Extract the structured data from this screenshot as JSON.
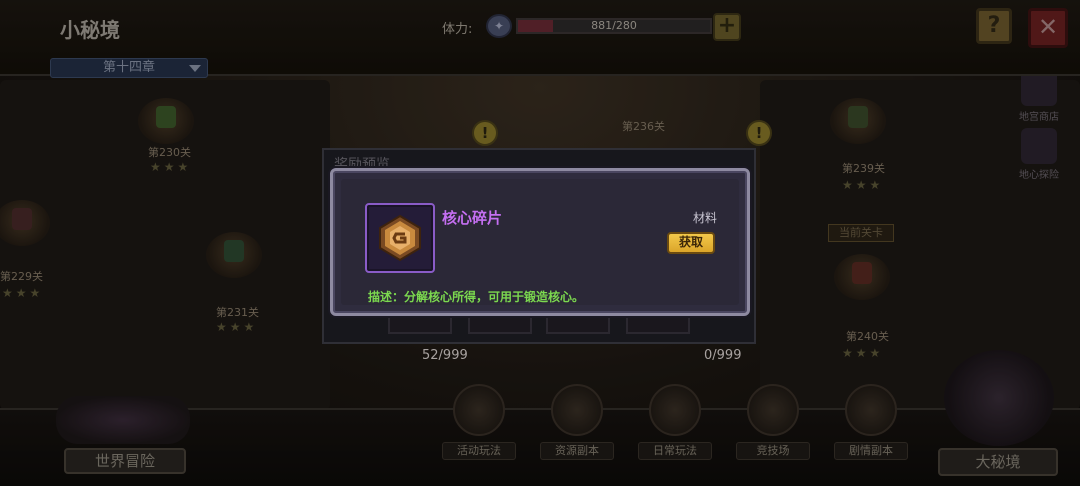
{
  "header": {
    "title": "小秘境",
    "chapter": "第十四章",
    "stamina_label": "体力:",
    "stamina_text": "881/280",
    "stamina_fraction": 0.18
  },
  "map": {
    "stages": [
      {
        "label": "第230关"
      },
      {
        "label": "第229关"
      },
      {
        "label": "第231关"
      },
      {
        "label": "第239关"
      },
      {
        "label": "第240关"
      },
      {
        "label": "第236关"
      }
    ],
    "current_stage": "当前关卡",
    "star_glyph": "★★★",
    "alert_glyph": "!"
  },
  "side": {
    "shop_label": "地宫商店",
    "explore_label": "地心探险"
  },
  "reward_panel": {
    "title": "奖励预览",
    "count_left": "52/999",
    "count_right": "0/999"
  },
  "dialog": {
    "item_name": "核心碎片",
    "item_type": "材料",
    "obtain_label": "获取",
    "description": "描述：分解核心所得，可用于锻造核心。"
  },
  "bottom_nav": {
    "world": "世界冒险",
    "activity": "活动玩法",
    "resource": "资源副本",
    "daily": "日常玩法",
    "arena": "竞技场",
    "story": "剧情副本",
    "big_secret": "大秘境"
  },
  "colors": {
    "item_name": "#c56ff2",
    "description": "#7bd84f",
    "obtain_button": "#f3c84a",
    "item_frame": "#8a5cc7"
  },
  "icons": {
    "item": "core-fragment-icon",
    "help": "question-mark-icon",
    "close": "close-x-icon",
    "stamina": "stamina-potion-icon",
    "add": "plus-icon"
  }
}
